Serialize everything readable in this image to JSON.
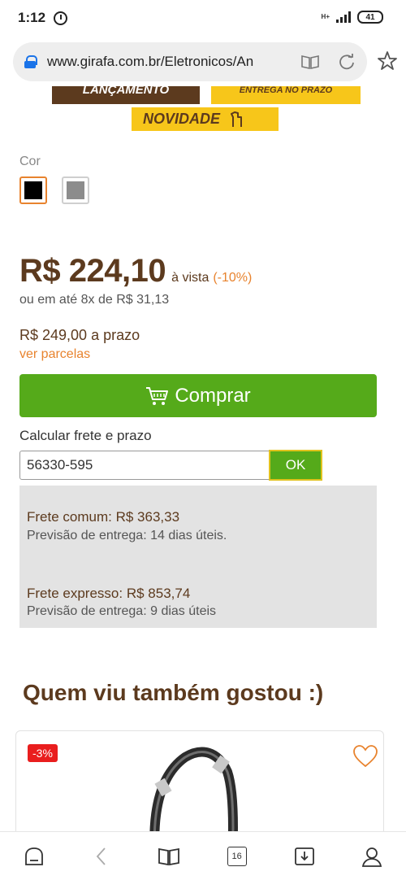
{
  "status_bar": {
    "time": "1:12",
    "network": "H+",
    "battery": "41"
  },
  "browser": {
    "url": "www.girafa.com.br/Eletronicos/An",
    "tabs_count": "16"
  },
  "badges": {
    "launch": "LANÇAMENTO",
    "delivery": "ENTREGA NO PRAZO",
    "new": "NOVIDADE"
  },
  "product": {
    "color_label": "Cor",
    "colors": [
      {
        "name": "preto",
        "hex": "#000000",
        "selected": true
      },
      {
        "name": "cinza",
        "hex": "#8c8c8c",
        "selected": false
      }
    ],
    "price": "R$ 224,10",
    "price_cash_label": "à vista",
    "price_discount": "(-10%)",
    "installments": "ou em até 8x de R$ 31,13",
    "term_price": "R$ 249,00",
    "term_label": "a prazo",
    "installments_link": "ver parcelas",
    "buy_label": "Comprar"
  },
  "shipping": {
    "label": "Calcular frete e prazo",
    "cep_value": "56330-595",
    "ok_label": "OK",
    "options": [
      {
        "title": "Frete comum: R$ 363,33",
        "subtitle": "Previsão de entrega: 14 dias úteis."
      },
      {
        "title": "Frete expresso: R$ 853,74",
        "subtitle": "Previsão de entrega: 9 dias úteis"
      }
    ]
  },
  "related": {
    "title": "Quem viu também gostou :)",
    "items": [
      {
        "discount": "-3%"
      }
    ]
  },
  "colors": {
    "brown": "#5c3a1e",
    "orange": "#e8832e",
    "green": "#55aa1a",
    "yellow": "#f7c61a",
    "red": "#e91e1e"
  },
  "nav": {
    "items": [
      "home-icon",
      "back-icon",
      "bookmarks-icon",
      "tabs-icon",
      "downloads-icon",
      "profile-icon"
    ]
  }
}
